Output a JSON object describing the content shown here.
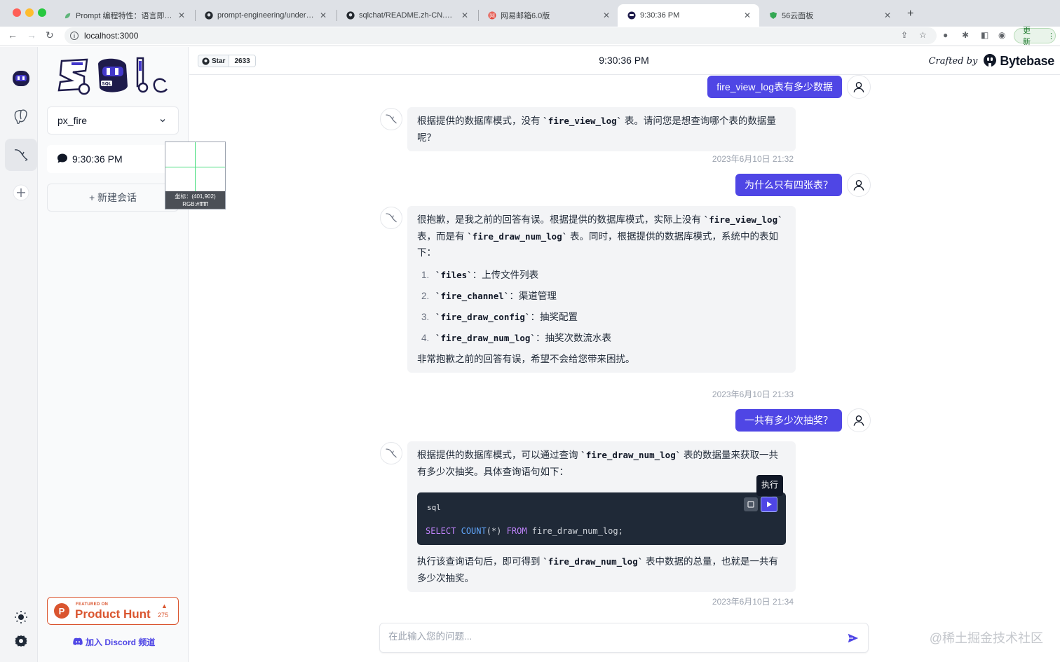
{
  "browser": {
    "tabs": [
      {
        "title": "Prompt 编程特性：语言即语言"
      },
      {
        "title": "prompt-engineering/understanding"
      },
      {
        "title": "sqlchat/README.zh-CN.md at"
      },
      {
        "title": "网易邮箱6.0版"
      },
      {
        "title": "9:30:36 PM"
      },
      {
        "title": "56云面板"
      }
    ],
    "url": "localhost:3000",
    "update_label": "更新"
  },
  "sidebar": {
    "database_select": "px_fire",
    "conversation_title": "9:30:36 PM",
    "new_conversation_label": "+ 新建会话",
    "product_hunt": {
      "featured": "FEATURED ON",
      "name": "Product Hunt",
      "votes": "275"
    },
    "discord_label": "加入 Discord 频道"
  },
  "picker": {
    "coords": "坐标：(401,902)",
    "rgb": "RGB:#ffffff"
  },
  "header": {
    "star_label": "Star",
    "star_count": "2633",
    "title": "9:30:36 PM",
    "crafted_by": "Crafted by",
    "brand": "Bytebase"
  },
  "messages": {
    "u1": "fire_view_log表有多少数据",
    "b1_a": "根据提供的数据库模式，没有 ",
    "b1_code": "`fire_view_log`",
    "b1_b": " 表。请问您是想查询哪个表的数据量呢？",
    "t1": "2023年6月10日 21:32",
    "u2": "为什么只有四张表？",
    "b2_a": "很抱歉，是我之前的回答有误。根据提供的数据库模式，实际上没有 ",
    "b2_code1": "`fire_view_log`",
    "b2_b": " 表，而是有 ",
    "b2_code2": "`fire_draw_num_log`",
    "b2_c": " 表。同时，根据提供的数据库模式，系统中的表如下：",
    "b2_list": [
      {
        "num": "1.",
        "code": "`files`",
        "desc": "：上传文件列表"
      },
      {
        "num": "2.",
        "code": "`fire_channel`",
        "desc": "：渠道管理"
      },
      {
        "num": "3.",
        "code": "`fire_draw_config`",
        "desc": "：抽奖配置"
      },
      {
        "num": "4.",
        "code": "`fire_draw_num_log`",
        "desc": "：抽奖次数流水表"
      }
    ],
    "b2_end": "非常抱歉之前的回答有误，希望不会给您带来困扰。",
    "t2": "2023年6月10日 21:33",
    "u3": "一共有多少次抽奖？",
    "b3_a": "根据提供的数据库模式，可以通过查询 ",
    "b3_code": "`fire_draw_num_log`",
    "b3_b": " 表的数据量来获取一共有多少次抽奖。具体查询语句如下：",
    "code_lang": "sql",
    "run_tooltip": "执行",
    "sql_kw1": "SELECT",
    "sql_fn": "COUNT",
    "sql_args": "(*)",
    "sql_kw2": "FROM",
    "sql_rest": "fire_draw_num_log;",
    "b3_c": "执行该查询语句后，即可得到 ",
    "b3_code2": "`fire_draw_num_log`",
    "b3_d": " 表中数据的总量，也就是一共有多少次抽奖。",
    "t3": "2023年6月10日 21:34"
  },
  "input": {
    "placeholder": "在此输入您的问题..."
  },
  "watermark": "@稀土掘金技术社区",
  "colors": {
    "accent": "#4f46e5",
    "product_hunt": "#da552f"
  }
}
